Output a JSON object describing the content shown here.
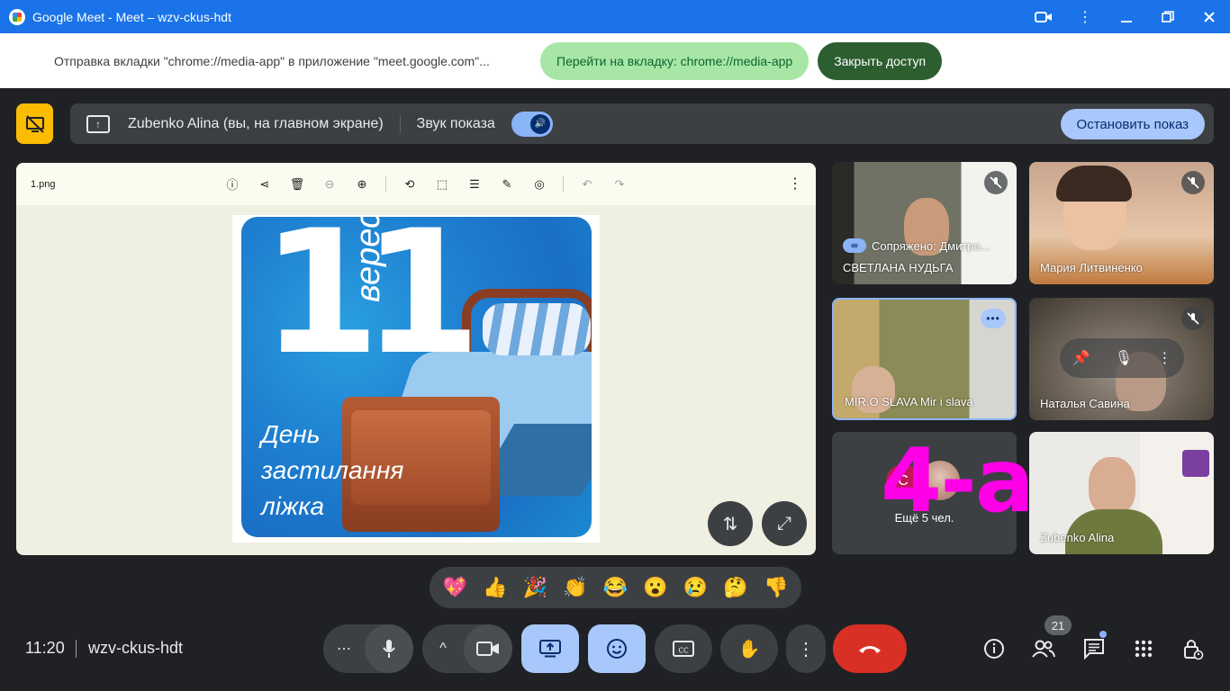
{
  "window": {
    "title": "Google Meet - Meet – wzv-ckus-hdt",
    "controls": [
      "camera-icon",
      "more-vert-icon",
      "minimize-icon",
      "restore-icon",
      "close-icon"
    ]
  },
  "share_bar": {
    "message": "Отправка вкладки \"chrome://media-app\" в приложение \"meet.google.com\"...",
    "go_to_tab": "Перейти на вкладку: chrome://media-app",
    "stop_access": "Закрыть доступ"
  },
  "presentation": {
    "presenter": "Zubenko Alina (вы, на главном экране)",
    "audio_label": "Звук показа",
    "audio_on": true,
    "stop_button": "Остановить показ"
  },
  "viewer": {
    "filename": "1.png",
    "tools": [
      "info-icon",
      "share-icon",
      "delete-icon",
      "zoom-out-icon",
      "zoom-in-icon",
      "rotate-icon",
      "crop-icon",
      "adjust-icon",
      "draw-icon",
      "lighting-icon",
      "undo-icon",
      "redo-icon"
    ],
    "image": {
      "number": "11",
      "month": "вересня",
      "caption_lines": [
        "День",
        "застилання",
        "ліжка"
      ]
    }
  },
  "participants": [
    {
      "name": "СВЕТЛАНА НУДЬГА",
      "linked": "Сопряжено: Дмитро...",
      "muted": true
    },
    {
      "name": "Мария Литвиненко",
      "muted": true
    },
    {
      "name": "MIR.O SLAVA Mir i slava",
      "muted": false,
      "active": true
    },
    {
      "name": "Наталья Савина",
      "muted": true
    },
    {
      "name": "Ещё 5 чел.",
      "initial": "С"
    },
    {
      "name": "Zubenko Alina",
      "muted": false
    }
  ],
  "overlay_text": "4-а",
  "reactions": [
    "💖",
    "👍",
    "🎉",
    "👏",
    "😂",
    "😮",
    "😢",
    "🤔",
    "👎"
  ],
  "bottom": {
    "time": "11:20",
    "meeting_code": "wzv-ckus-hdt",
    "participant_count": "21"
  }
}
